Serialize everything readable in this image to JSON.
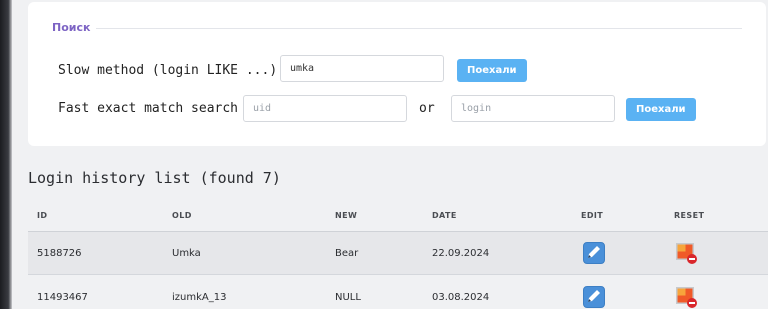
{
  "search": {
    "legend": "Поиск",
    "slow": {
      "label": "Slow method (login LIKE ...)",
      "value": "umka",
      "button": "Поехали"
    },
    "fast": {
      "label": "Fast exact match search",
      "uid_placeholder": "uid",
      "or_label": "or",
      "login_placeholder": "login",
      "button": "Поехали"
    }
  },
  "history": {
    "title": "Login history list (found 7)",
    "columns": [
      "ID",
      "OLD",
      "NEW",
      "DATE",
      "EDIT",
      "RESET"
    ],
    "rows": [
      {
        "id": "5188726",
        "old": "Umka",
        "new": "Bear",
        "date": "22.09.2024"
      },
      {
        "id": "11493467",
        "old": "izumkA_13",
        "new": "NULL",
        "date": "03.08.2024"
      }
    ]
  },
  "colors": {
    "accent": "#5ab2f3",
    "legend": "#7d64c4",
    "edit_icon": "#4a90d9",
    "reset_icon": "#e8502a"
  },
  "icons": {
    "edit": "pencil-icon",
    "reset": "reset-image-icon"
  }
}
